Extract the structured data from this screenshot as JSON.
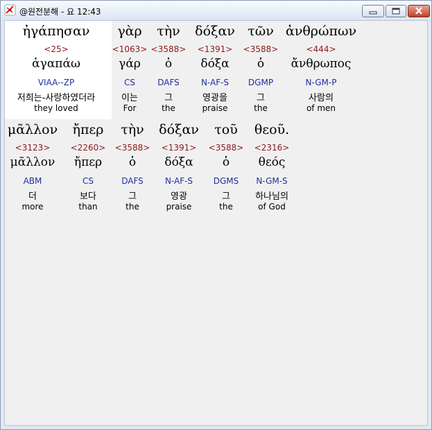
{
  "window": {
    "title": "@원전분해 - 요 12:43"
  },
  "colors": {
    "strong_number": "#8b1a1a",
    "parsing": "#1f2fa0",
    "highlight": "#ffffff"
  },
  "icons": {
    "app": "bible-cross-icon",
    "minimize": "minimize-icon",
    "maximize": "maximize-icon",
    "close": "close-icon"
  },
  "words": [
    {
      "greek": "ἠγάπησαν",
      "strong": "<25>",
      "lemma": "ἀγαπάω",
      "parsing": "VIAA--ZP",
      "korean": "저희는-사랑하였더라",
      "english": "they loved"
    },
    {
      "greek": "γὰρ",
      "strong": "<1063>",
      "lemma": "γάρ",
      "parsing": "CS",
      "korean": "이는",
      "english": "For"
    },
    {
      "greek": "τὴν",
      "strong": "<3588>",
      "lemma": "ὁ",
      "parsing": "DAFS",
      "korean": "그",
      "english": "the"
    },
    {
      "greek": "δόξαν",
      "strong": "<1391>",
      "lemma": "δόξα",
      "parsing": "N-AF-S",
      "korean": "영광을",
      "english": "praise"
    },
    {
      "greek": "τῶν",
      "strong": "<3588>",
      "lemma": "ὁ",
      "parsing": "DGMP",
      "korean": "그",
      "english": "the"
    },
    {
      "greek": "ἀνθρώπων",
      "strong": "<444>",
      "lemma": "ἄνθρωπος",
      "parsing": "N-GM-P",
      "korean": "사람의",
      "english": "of men"
    },
    {
      "greek": "μᾶλλον",
      "strong": "<3123>",
      "lemma": "μᾶλλον",
      "parsing": "ABM",
      "korean": "더",
      "english": "more"
    },
    {
      "greek": "ἤπερ",
      "strong": "<2260>",
      "lemma": "ἤπερ",
      "parsing": "CS",
      "korean": "보다",
      "english": "than"
    },
    {
      "greek": "τὴν",
      "strong": "<3588>",
      "lemma": "ὁ",
      "parsing": "DAFS",
      "korean": "그",
      "english": "the"
    },
    {
      "greek": "δόξαν",
      "strong": "<1391>",
      "lemma": "δόξα",
      "parsing": "N-AF-S",
      "korean": "영광",
      "english": "praise"
    },
    {
      "greek": "τοῦ",
      "strong": "<3588>",
      "lemma": "ὁ",
      "parsing": "DGMS",
      "korean": "그",
      "english": "the"
    },
    {
      "greek": "θεοῦ.",
      "strong": "<2316>",
      "lemma": "θεός",
      "parsing": "N-GM-S",
      "korean": "하나님의",
      "english": "of God"
    }
  ]
}
